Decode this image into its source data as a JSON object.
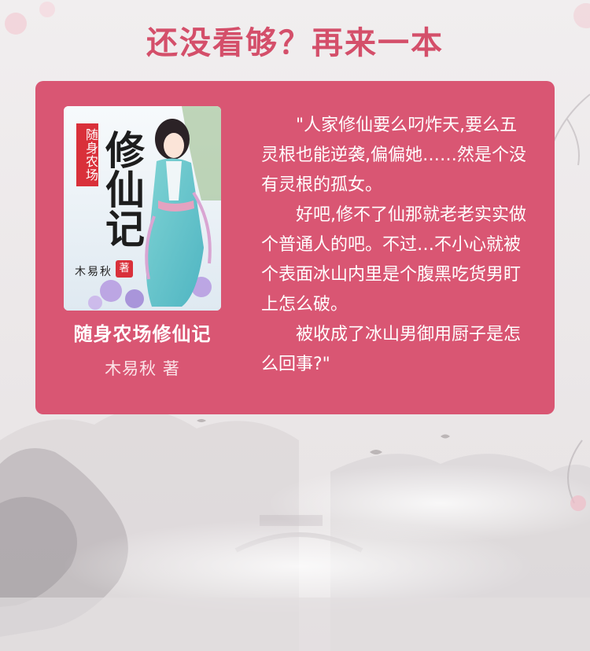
{
  "headline": "还没看够？再来一本",
  "book": {
    "title": "随身农场修仙记",
    "author": "木易秋 著",
    "cover": {
      "series_label": "随身农场",
      "big_title": "修仙记",
      "author": "木易秋",
      "seal": "著"
    }
  },
  "synopsis": {
    "paragraphs": [
      "\"人家修仙要么叼炸天,要么五灵根也能逆袭,偏偏她……然是个没有灵根的孤女。",
      "好吧,修不了仙那就老老实实做个普通人的吧。不过…不小心就被个表面冰山内里是个腹黑吃货男盯上怎么破。",
      "被收成了冰山男御用厨子是怎么回事?\""
    ]
  },
  "colors": {
    "headline": "#d44f6a",
    "card": "#d95673",
    "text": "#ffffff"
  }
}
